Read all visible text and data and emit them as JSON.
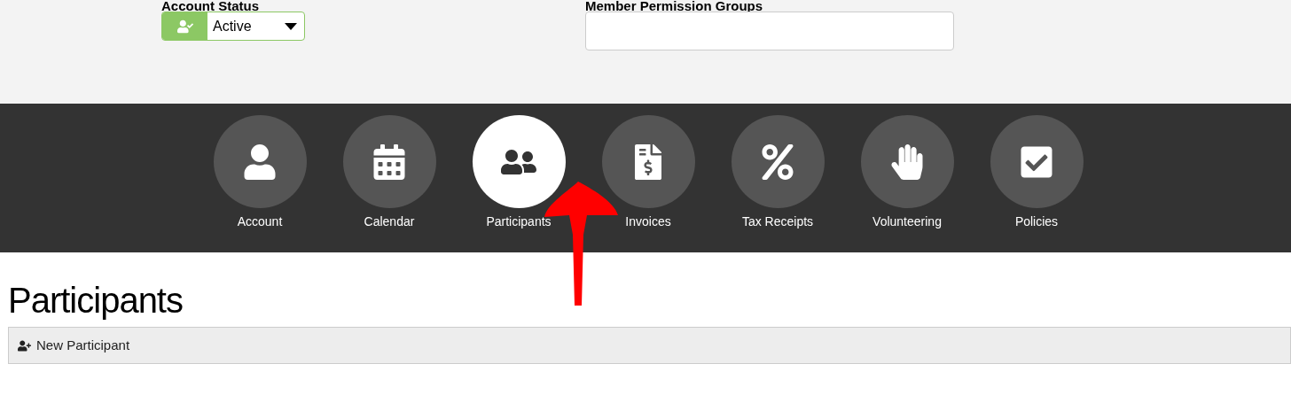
{
  "account_status": {
    "label": "Account Status",
    "value": "Active"
  },
  "permission_groups": {
    "label": "Member Permission Groups"
  },
  "nav": [
    {
      "label": "Account",
      "selected": false
    },
    {
      "label": "Calendar",
      "selected": false
    },
    {
      "label": "Participants",
      "selected": true
    },
    {
      "label": "Invoices",
      "selected": false
    },
    {
      "label": "Tax Receipts",
      "selected": false
    },
    {
      "label": "Volunteering",
      "selected": false
    },
    {
      "label": "Policies",
      "selected": false
    }
  ],
  "heading": "Participants",
  "toolbar": {
    "new_button": "New Participant"
  }
}
